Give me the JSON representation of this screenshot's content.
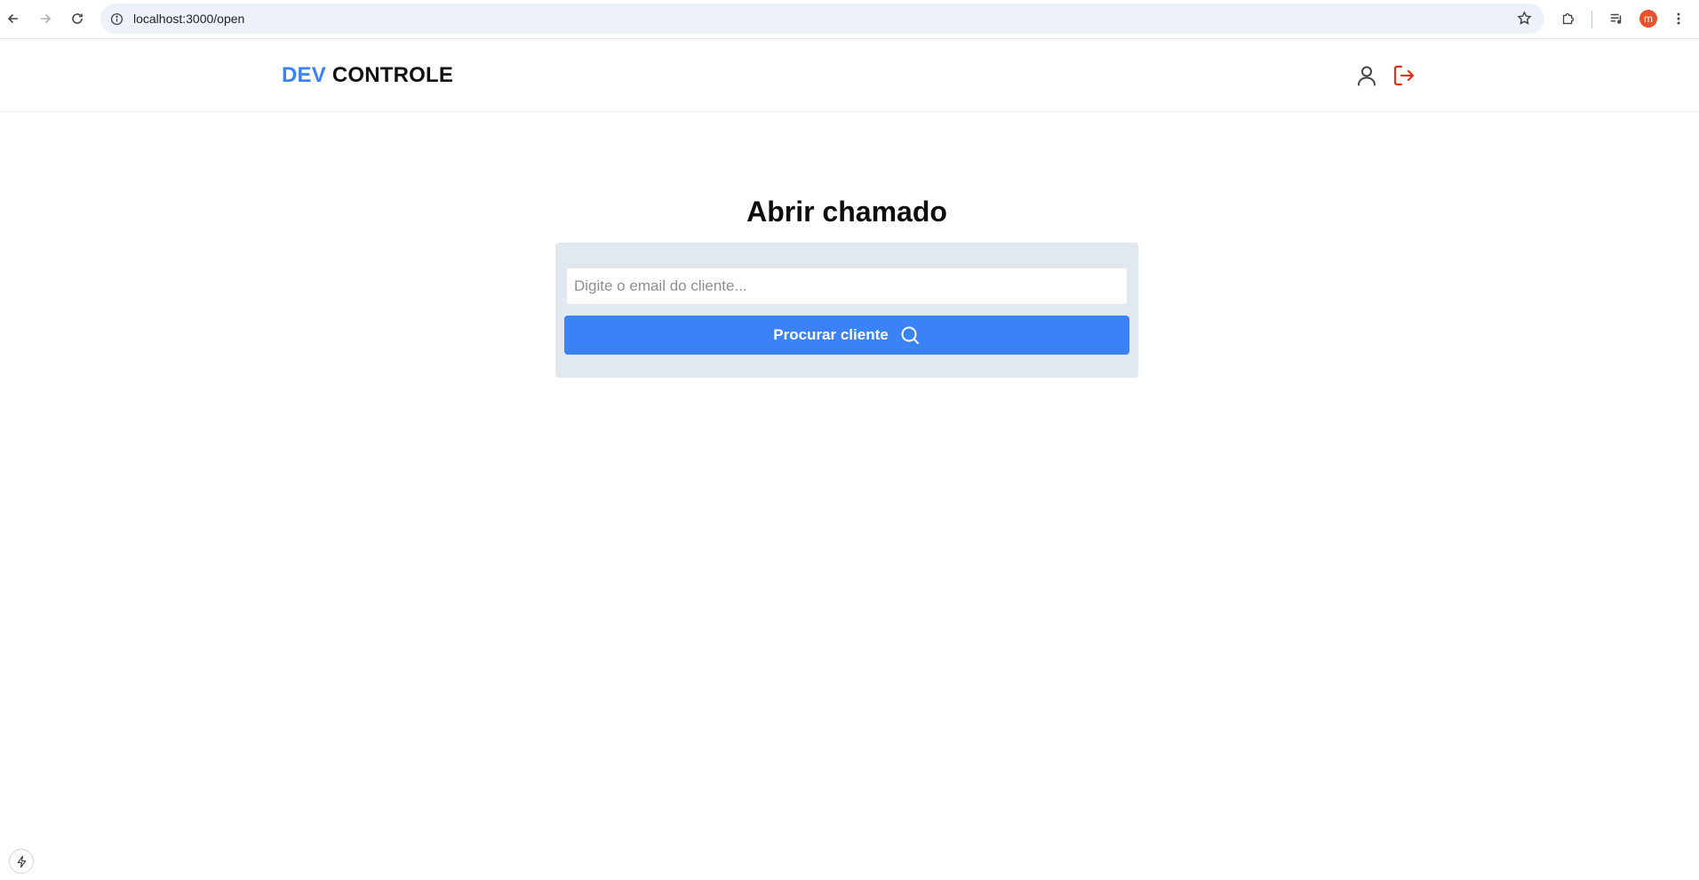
{
  "browser": {
    "url": "localhost:3000/open",
    "profile_initial": "m"
  },
  "header": {
    "brand_primary": "DEV",
    "brand_secondary": "CONTROLE"
  },
  "main": {
    "title": "Abrir chamado",
    "email_placeholder": "Digite o email do cliente...",
    "search_button_label": "Procurar cliente"
  },
  "icons": {
    "back": "arrow-left-icon",
    "forward": "arrow-right-icon",
    "reload": "reload-icon",
    "site_info": "info-icon",
    "bookmark": "star-icon",
    "extensions": "puzzle-icon",
    "media": "media-queue-icon",
    "menu": "kebab-menu-icon",
    "user": "user-icon",
    "logout": "logout-icon",
    "search": "search-icon",
    "dev_indicator": "lightning-icon"
  },
  "colors": {
    "accent": "#3b82f6",
    "logout": "#e0321d",
    "card_bg": "#e2e8f0"
  }
}
